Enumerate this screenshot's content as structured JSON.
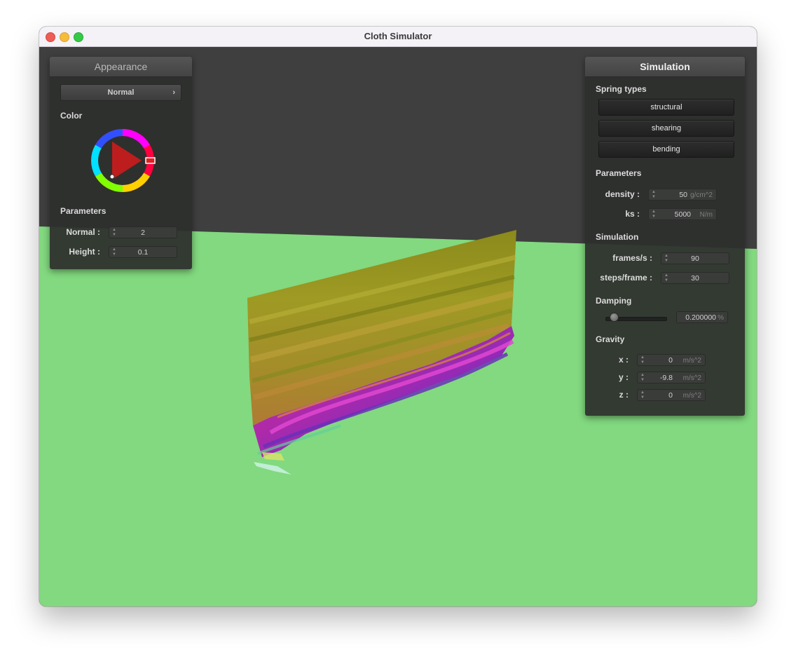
{
  "window": {
    "title": "Cloth Simulator"
  },
  "appearance": {
    "title": "Appearance",
    "shader_selected": "Normal",
    "color_label": "Color",
    "parameters_label": "Parameters",
    "normal": {
      "label": "Normal :",
      "value": "2"
    },
    "height": {
      "label": "Height :",
      "value": "0.1"
    },
    "wheel_color": "#e02020"
  },
  "simulation": {
    "title": "Simulation",
    "spring_types_label": "Spring types",
    "springs": [
      "structural",
      "shearing",
      "bending"
    ],
    "parameters_label": "Parameters",
    "density": {
      "label": "density :",
      "value": "50",
      "unit": "g/cm^2"
    },
    "ks": {
      "label": "ks :",
      "value": "5000",
      "unit": "N/m"
    },
    "simulation_label": "Simulation",
    "fps": {
      "label": "frames/s :",
      "value": "90"
    },
    "steps": {
      "label": "steps/frame :",
      "value": "30"
    },
    "damping_label": "Damping",
    "damping": {
      "value": "0.200000",
      "unit": "%",
      "fraction": 0.2
    },
    "gravity_label": "Gravity",
    "gravity": [
      {
        "label": "x :",
        "value": "0",
        "unit": "m/s^2"
      },
      {
        "label": "y :",
        "value": "-9.8",
        "unit": "m/s^2"
      },
      {
        "label": "z :",
        "value": "0",
        "unit": "m/s^2"
      }
    ]
  },
  "scene": {
    "sky_color": "#3f3f3f",
    "ground_color": "#82d97f"
  }
}
